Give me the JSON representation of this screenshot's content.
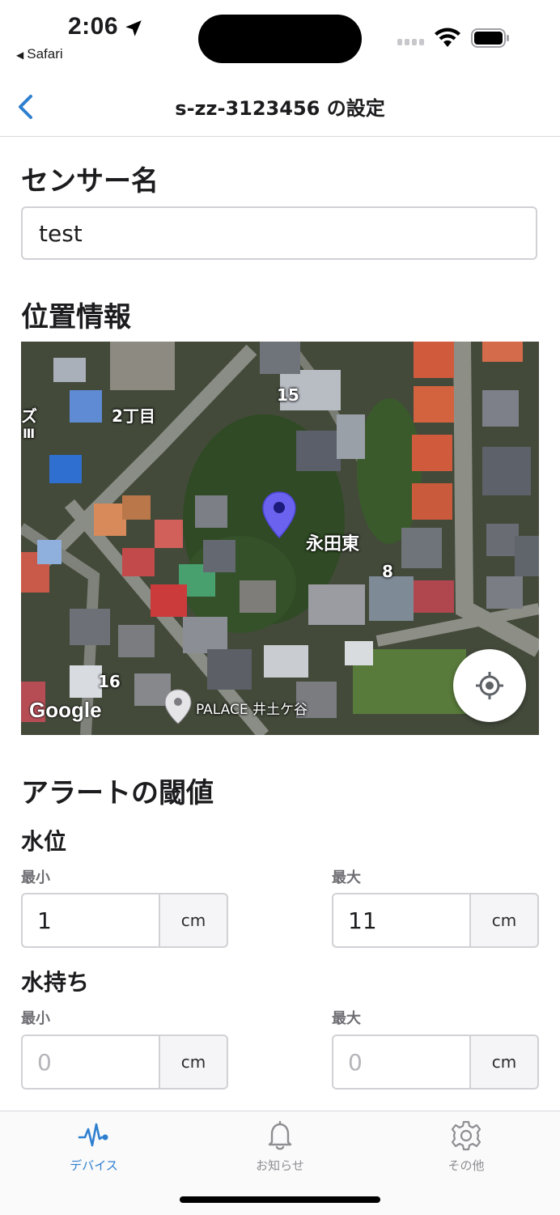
{
  "status_bar": {
    "time": "2:06",
    "back_app": "Safari"
  },
  "nav": {
    "title": "s-zz-3123456 の設定",
    "back_icon": "chevron-left-icon",
    "accent": "#2f7fd0"
  },
  "sensor_name": {
    "heading": "センサー名",
    "value": "test"
  },
  "location": {
    "heading": "位置情報",
    "map_labels": [
      "2丁目",
      "15",
      "永田東",
      "8",
      "16",
      "PALACE 井土ケ谷",
      "ズ",
      "Ⅲ"
    ],
    "google": "Google",
    "pin_color": "#6b63f0"
  },
  "thresholds": {
    "heading": "アラートの閾値",
    "water_level": {
      "title": "水位",
      "min_label": "最小",
      "min_value": "1",
      "min_unit": "cm",
      "max_label": "最大",
      "max_value": "11",
      "max_unit": "cm"
    },
    "water_hold": {
      "title": "水持ち",
      "min_label": "最小",
      "min_placeholder": "0",
      "min_unit": "cm",
      "max_label": "最大",
      "max_placeholder": "0",
      "max_unit": "cm"
    }
  },
  "tabbar": {
    "items": [
      {
        "label": "デバイス",
        "icon": "pulse-icon",
        "active": true
      },
      {
        "label": "お知らせ",
        "icon": "bell-icon",
        "active": false
      },
      {
        "label": "その他",
        "icon": "gear-icon",
        "active": false
      }
    ]
  }
}
